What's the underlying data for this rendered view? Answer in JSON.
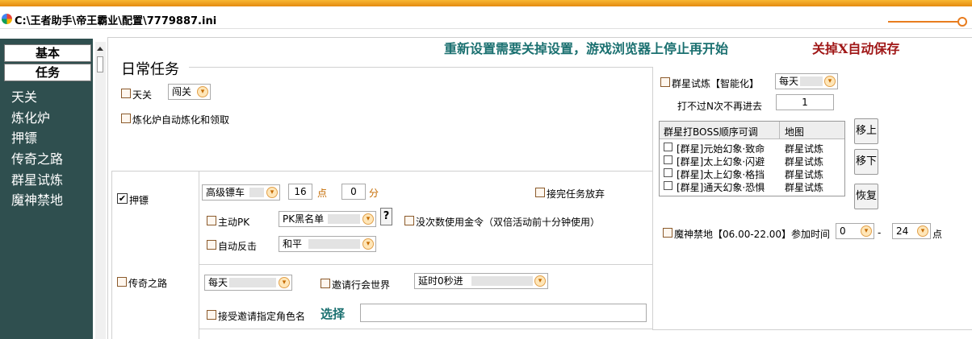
{
  "window": {
    "title": "C:\\王者助手\\帝王霸业\\配置\\7779887.ini"
  },
  "sidebar": {
    "buttons": [
      "基本",
      "任务"
    ],
    "items": [
      "天关",
      "炼化炉",
      "押镖",
      "传奇之路",
      "群星试炼",
      "魔神禁地"
    ]
  },
  "banner": {
    "notice": "重新设置需要关掉设置，游戏浏览器上停止再开始",
    "warning": "关掉X自动保存"
  },
  "daily": {
    "title": "日常任务",
    "tianguan": {
      "label": "天关",
      "option": "闯关"
    },
    "lianhua": {
      "label": "炼化炉自动炼化和领取"
    }
  },
  "escort": {
    "label": "押镖",
    "cart": "高级镖车",
    "hour": "16",
    "hour_unit": "点",
    "minute": "0",
    "minute_unit": "分",
    "finish_abandon": "接完任务放弃",
    "pk_label": "主动PK",
    "pk_option": "PK黑名单",
    "help": "?",
    "gold_label": "没次数使用金令（双倍活动前十分钟使用）",
    "counter_label": "自动反击",
    "counter_option": "和平"
  },
  "legend": {
    "label": "传奇之路",
    "freq": "每天",
    "invite_label": "邀请行会世界",
    "delay": "延时0秒进",
    "accept_label": "接受邀请指定角色名",
    "select_link": "选择",
    "name_value": ""
  },
  "star": {
    "label": "群星试炼【智能化】",
    "freq": "每天",
    "retry_label": "打不过N次不再进去",
    "retry_value": "1",
    "table": {
      "headers": [
        "群星打BOSS顺序可调",
        "地图"
      ],
      "rows": [
        {
          "name": "[群星]元始幻象·致命",
          "map": "群星试炼"
        },
        {
          "name": "[群星]太上幻象·闪避",
          "map": "群星试炼"
        },
        {
          "name": "[群星]太上幻象·格挡",
          "map": "群星试炼"
        },
        {
          "name": "[群星]通天幻象·恐惧",
          "map": "群星试炼"
        }
      ]
    },
    "buttons": [
      "移上",
      "移下",
      "恢复"
    ]
  },
  "demon": {
    "label": "魔神禁地【06.00-22.00】参加时间",
    "start": "0",
    "dash": "-",
    "end": "24",
    "unit": "点"
  },
  "colors": {
    "sidebar": "#2f4f4f",
    "accent": "#1a7070",
    "warning": "#a01818",
    "dropdown": "#e1a04a"
  }
}
